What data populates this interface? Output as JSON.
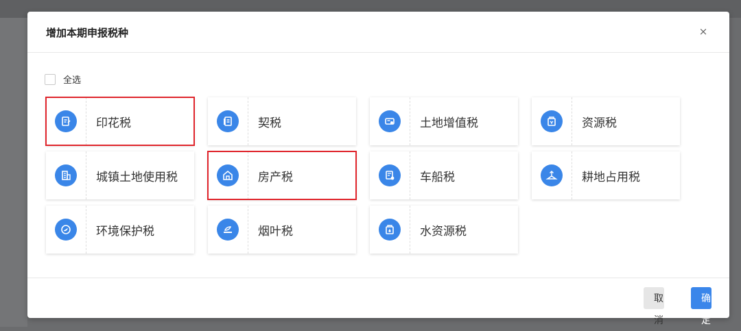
{
  "dialog": {
    "title": "增加本期申报税种",
    "close_icon": "close-icon",
    "close_glyph": "×",
    "select_all_label": "全选",
    "select_all_checked": false,
    "cancel_label": "取消",
    "ok_label": "确定"
  },
  "accent_color": "#3a86e8",
  "highlight_color": "#e0242b",
  "tax_types": [
    {
      "label": "印花税",
      "icon": "stamp-document-icon",
      "highlighted": true
    },
    {
      "label": "契税",
      "icon": "contract-document-icon",
      "highlighted": false
    },
    {
      "label": "土地增值税",
      "icon": "land-value-icon",
      "highlighted": false
    },
    {
      "label": "资源税",
      "icon": "resource-box-icon",
      "highlighted": false
    },
    {
      "label": "城镇土地使用税",
      "icon": "urban-building-icon",
      "highlighted": false
    },
    {
      "label": "房产税",
      "icon": "house-property-icon",
      "highlighted": true
    },
    {
      "label": "车船税",
      "icon": "vehicle-vessel-icon",
      "highlighted": false
    },
    {
      "label": "耕地占用税",
      "icon": "farmland-icon",
      "highlighted": false
    },
    {
      "label": "环境保护税",
      "icon": "environment-leaf-icon",
      "highlighted": false
    },
    {
      "label": "烟叶税",
      "icon": "tobacco-leaf-icon",
      "highlighted": false
    },
    {
      "label": "水资源税",
      "icon": "water-resource-icon",
      "highlighted": false
    }
  ]
}
